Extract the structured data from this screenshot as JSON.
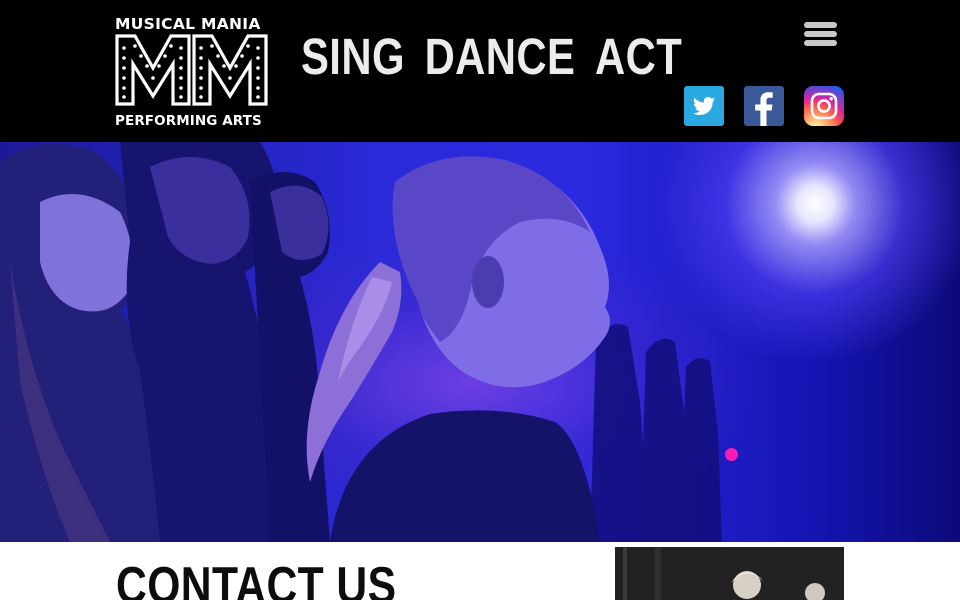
{
  "brand": {
    "top_text": "MUSICAL MANIA",
    "monogram": "MM",
    "bottom_text": "PERFORMING ARTS"
  },
  "tagline": [
    "SING",
    "DANCE",
    "ACT"
  ],
  "menu": {
    "icon": "hamburger-menu-icon"
  },
  "social": [
    {
      "name": "twitter",
      "icon": "twitter-icon",
      "color": "#2aa9e0"
    },
    {
      "name": "facebook",
      "icon": "facebook-icon",
      "color": "#3b5998"
    },
    {
      "name": "instagram",
      "icon": "instagram-icon",
      "color": "#d6249f"
    }
  ],
  "hero": {
    "slider_dot_color": "#ff1bb4"
  },
  "contact": {
    "title": "CONTACT US"
  }
}
